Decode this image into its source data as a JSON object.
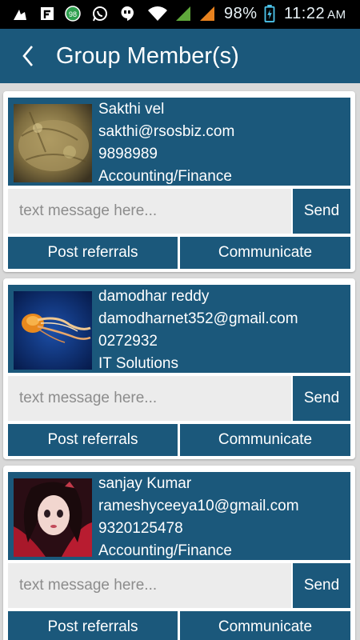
{
  "status_bar": {
    "battery": "98%",
    "time": "11:22",
    "ampm": "AM",
    "icons": [
      "usb-icon",
      "flipboard-icon",
      "badge-98-icon",
      "whatsapp-icon",
      "hangouts-icon",
      "wifi-icon",
      "signal-icon",
      "signal-2-icon",
      "battery-charging-icon"
    ]
  },
  "header": {
    "title": "Group Member(s)",
    "back_icon": "chevron-left-icon"
  },
  "colors": {
    "primary": "#1b587b",
    "background": "#d9d9d9",
    "input": "#ececec"
  },
  "members": [
    {
      "name": "Sakthi vel",
      "email": "sakthi@rsosbiz.com",
      "phone": "9898989",
      "category": "Accounting/Finance",
      "avatar": "stone-photo",
      "message_placeholder": "text message here...",
      "send_label": "Send",
      "post_label": "Post referrals",
      "communicate_label": "Communicate"
    },
    {
      "name": "damodhar reddy",
      "email": "damodharnet352@gmail.com",
      "phone": "0272932",
      "category": "IT Solutions",
      "avatar": "jellyfish-photo",
      "message_placeholder": "text message here...",
      "send_label": "Send",
      "post_label": "Post referrals",
      "communicate_label": "Communicate"
    },
    {
      "name": "sanjay Kumar",
      "email": "rameshyceeya10@gmail.com",
      "phone": "9320125478",
      "category": "Accounting/Finance",
      "avatar": "doll-photo",
      "message_placeholder": "text message here...",
      "send_label": "Send",
      "post_label": "Post referrals",
      "communicate_label": "Communicate"
    }
  ]
}
